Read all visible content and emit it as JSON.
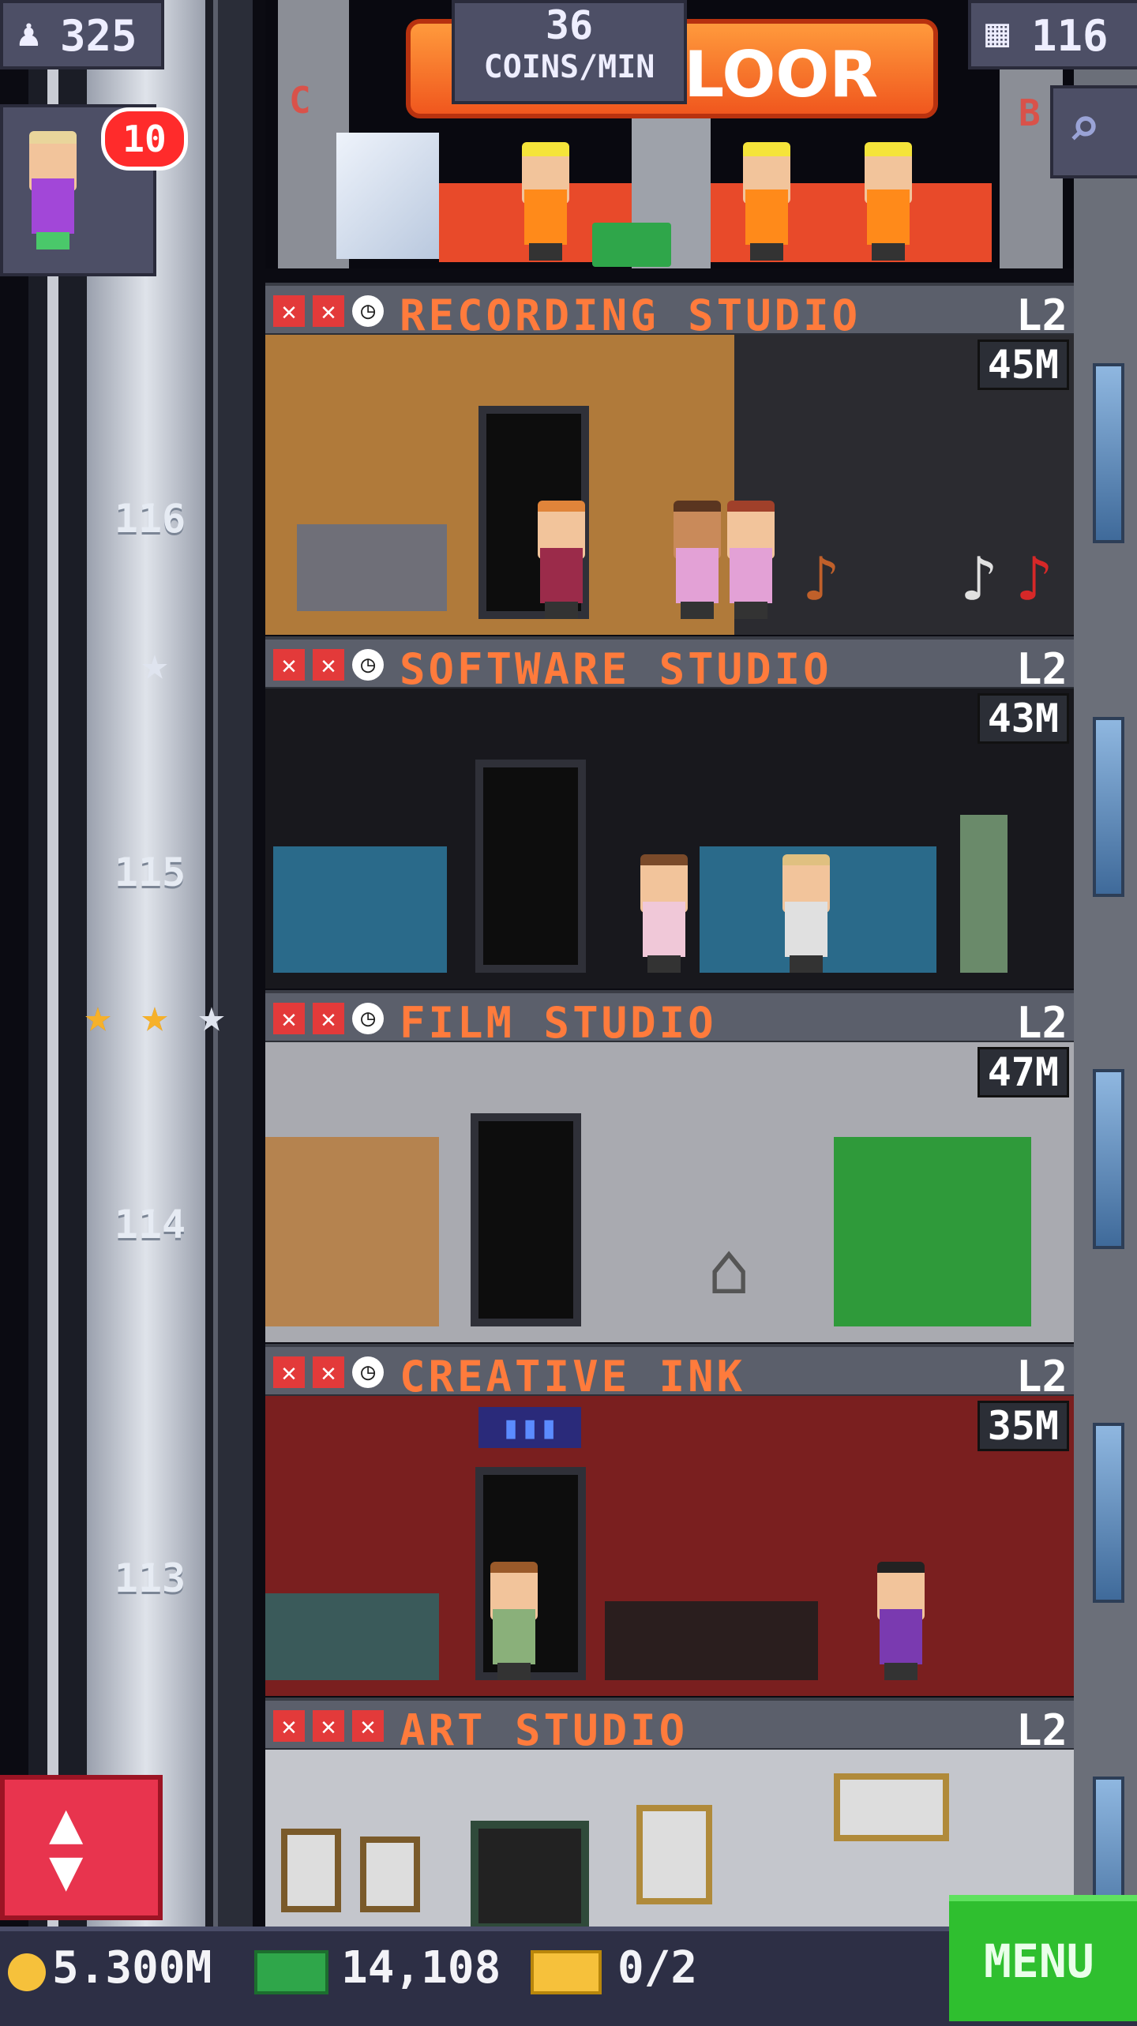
{
  "top_bar": {
    "population": "325",
    "coins_per_min_value": "36",
    "coins_per_min_label": "COINS/MIN",
    "build_button_label": "FLOOR",
    "floor_count": "116"
  },
  "notifications": {
    "badge_count": "10"
  },
  "construction_floor": {
    "left_letter": "C",
    "right_letter": "B"
  },
  "elevator": {
    "floor_labels": [
      "116",
      "115",
      "114",
      "113"
    ],
    "star_rows": [
      {
        "stars": [
          "silver"
        ]
      },
      {
        "stars": [
          "gold",
          "gold",
          "silver"
        ]
      }
    ]
  },
  "floors": [
    {
      "name": "RECORDING STUDIO",
      "level": "L2",
      "timer": "45M",
      "status_icons": [
        "x",
        "x",
        "clock"
      ],
      "theme": "#8a5a2b"
    },
    {
      "name": "SOFTWARE STUDIO",
      "level": "L2",
      "timer": "43M",
      "status_icons": [
        "x",
        "x",
        "clock"
      ],
      "theme": "#1a1a1f"
    },
    {
      "name": "FILM STUDIO",
      "level": "L2",
      "timer": "47M",
      "status_icons": [
        "x",
        "x",
        "clock"
      ],
      "theme": "#9c9da3"
    },
    {
      "name": "CREATIVE INK",
      "level": "L2",
      "timer": "35M",
      "status_icons": [
        "x",
        "x",
        "clock"
      ],
      "theme": "#7a1f1f"
    },
    {
      "name": "ART STUDIO",
      "level": "L2",
      "timer": "",
      "status_icons": [
        "x",
        "x",
        "x"
      ],
      "theme": "#b9bcc4"
    }
  ],
  "bottom_bar": {
    "coins": "5.300M",
    "bux": "14,108",
    "tickets": "0/2",
    "menu_label": "MENU"
  },
  "colors": {
    "floor_name": "#ff7b3c",
    "menu_green": "#2fbf2f",
    "elevator_button_red": "#e8344e"
  }
}
